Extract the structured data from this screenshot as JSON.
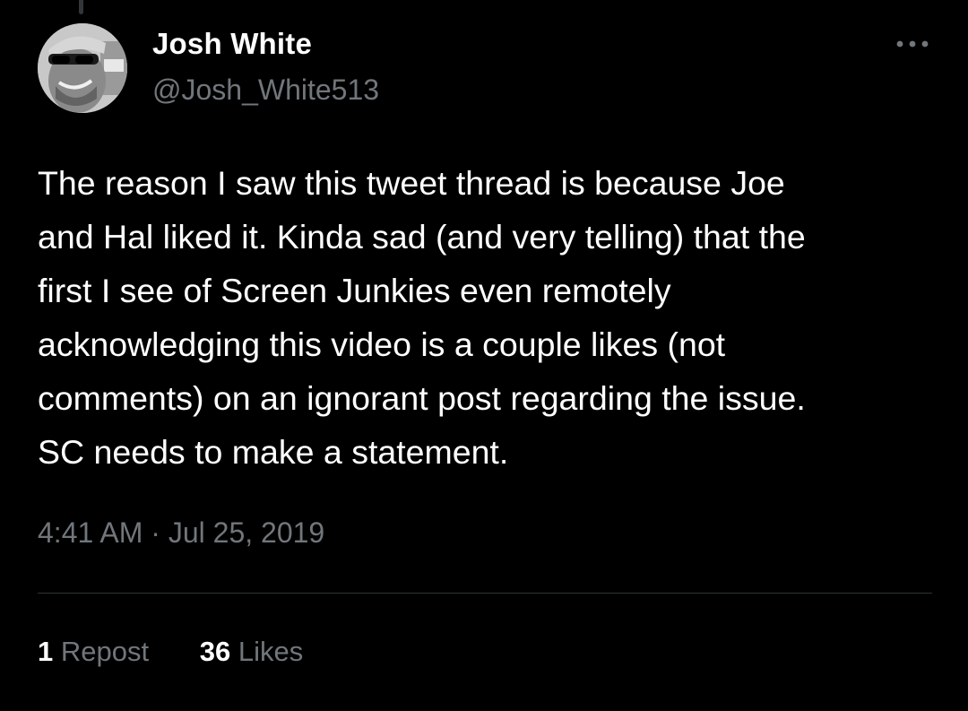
{
  "tweet": {
    "author": {
      "display_name": "Josh White",
      "handle": "@Josh_White513",
      "avatar": "profile-photo"
    },
    "text": "The reason I saw this tweet thread is because Joe\nand Hal liked it. Kinda sad (and very telling) that the\nfirst I see of Screen Junkies even remotely\nacknowledging this video is a couple likes (not\ncomments) on an ignorant post regarding the issue.\nSC needs to make a statement.",
    "time": "4:41 AM",
    "separator": "·",
    "date": "Jul 25, 2019",
    "stats": {
      "reposts": {
        "count": "1",
        "label": "Repost"
      },
      "likes": {
        "count": "36",
        "label": "Likes"
      }
    }
  },
  "icons": {
    "more": "more-horizontal-icon"
  },
  "colors": {
    "background": "#000000",
    "text_primary": "#ffffff",
    "text_secondary": "#71767b",
    "divider": "#2f3336"
  }
}
